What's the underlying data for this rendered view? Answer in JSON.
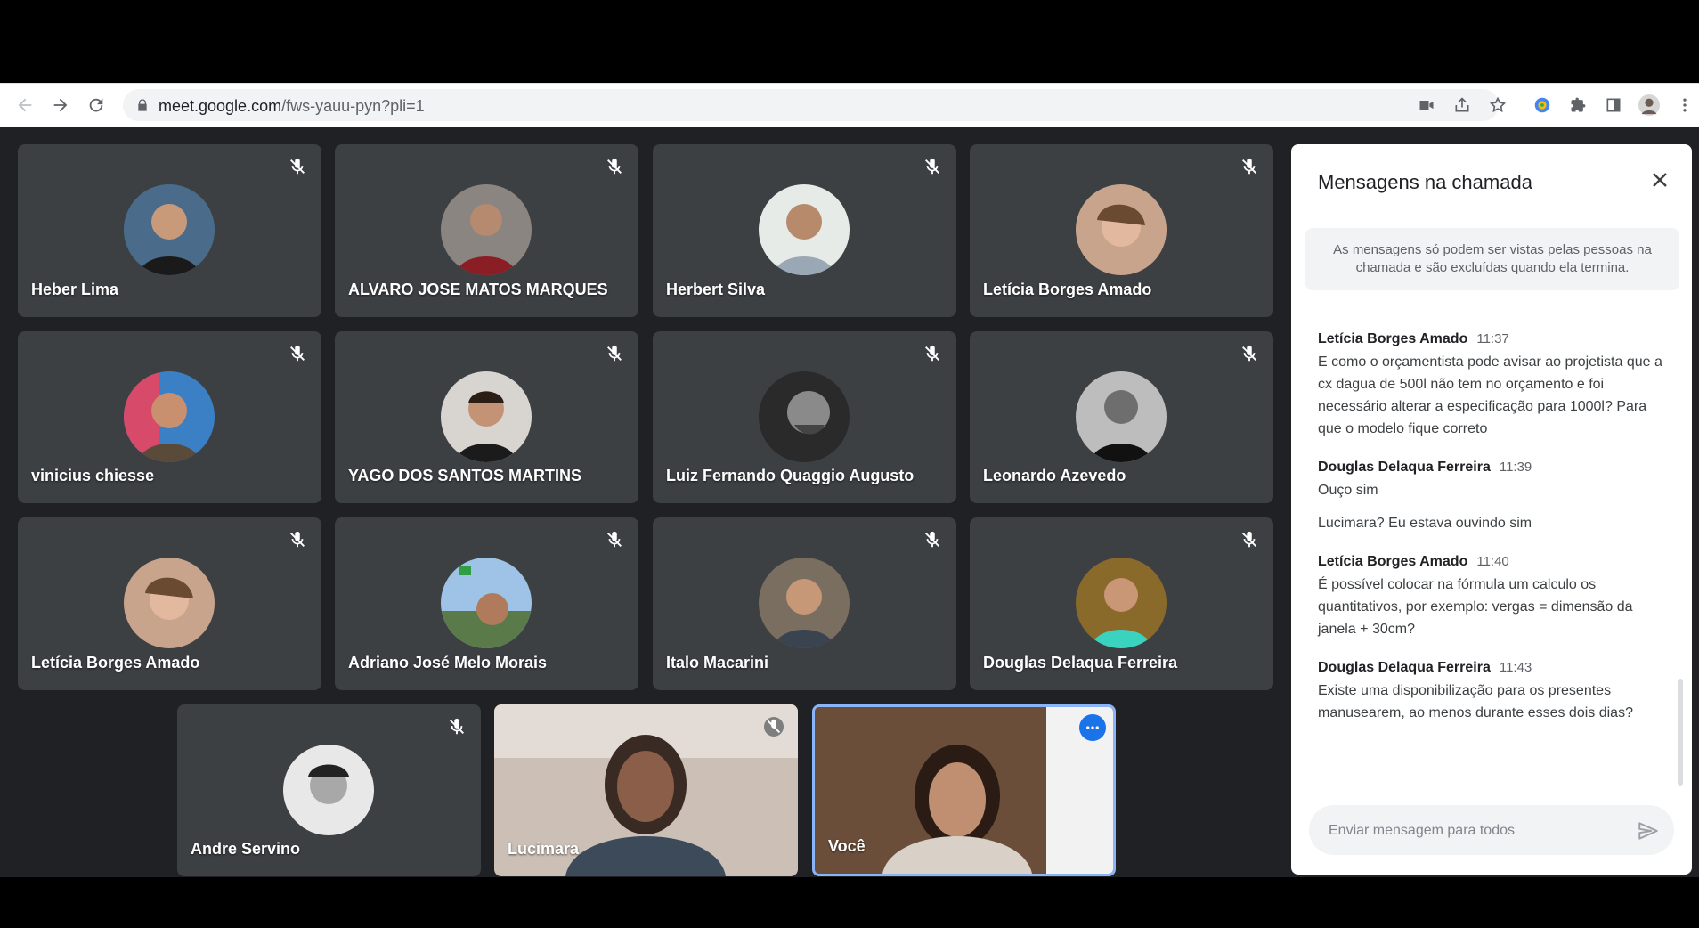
{
  "browser": {
    "url_host": "meet.google.com",
    "url_path": "/fws-yauu-pyn?pli=1"
  },
  "participants": [
    {
      "name": "Heber Lima",
      "muted": true
    },
    {
      "name": "ALVARO JOSE MATOS MARQUES",
      "muted": true
    },
    {
      "name": "Herbert Silva",
      "muted": true
    },
    {
      "name": "Letícia Borges Amado",
      "muted": true
    },
    {
      "name": "vinicius chiesse",
      "muted": true
    },
    {
      "name": "YAGO DOS SANTOS MARTINS",
      "muted": true
    },
    {
      "name": "Luiz Fernando Quaggio Augusto",
      "muted": true
    },
    {
      "name": "Leonardo Azevedo",
      "muted": true
    },
    {
      "name": "Letícia Borges Amado",
      "muted": true
    },
    {
      "name": "Adriano José Melo Morais",
      "muted": true
    },
    {
      "name": "Italo Macarini",
      "muted": true
    },
    {
      "name": "Douglas Delaqua Ferreira",
      "muted": true
    },
    {
      "name": "Andre Servino",
      "muted": true
    },
    {
      "name": "Lucimara",
      "muted": true
    },
    {
      "name": "Você",
      "muted": false
    }
  ],
  "chat": {
    "title": "Mensagens na chamada",
    "notice": "As mensagens só podem ser vistas pelas pessoas na chamada e são excluídas quando ela termina.",
    "messages": [
      {
        "sender": "Letícia Borges Amado",
        "time": "11:37",
        "texts": [
          "E como o orçamentista pode avisar ao projetista que a cx dagua de 500l não tem no orçamento e foi necessário alterar a especificação para 1000l? Para que o modelo fique correto"
        ]
      },
      {
        "sender": "Douglas Delaqua Ferreira",
        "time": "11:39",
        "texts": [
          "Ouço sim",
          "Lucimara? Eu estava ouvindo sim"
        ]
      },
      {
        "sender": "Letícia Borges Amado",
        "time": "11:40",
        "texts": [
          "É possível colocar na fórmula um calculo os quantitativos, por exemplo: vergas = dimensão da janela + 30cm?"
        ]
      },
      {
        "sender": "Douglas Delaqua Ferreira",
        "time": "11:43",
        "texts": [
          "Existe uma disponibilização para os presentes manusearem, ao menos durante esses dois dias?"
        ]
      }
    ],
    "input_placeholder": "Enviar mensagem para todos"
  },
  "colors": {
    "tile_bg": "#3c4043",
    "stage_bg": "#202124",
    "self_border": "#8ab4f8",
    "accent": "#1a73e8"
  }
}
